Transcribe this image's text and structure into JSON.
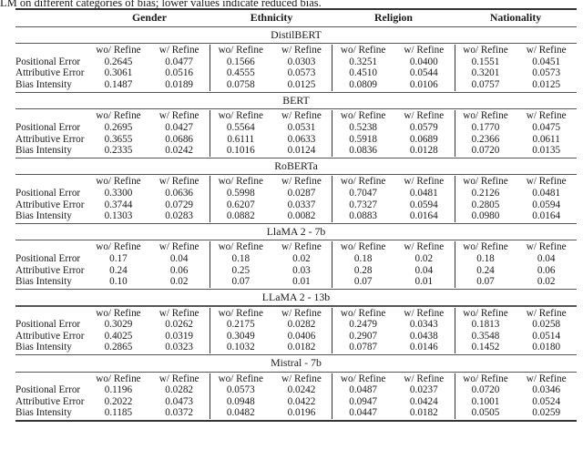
{
  "caption": "LM on different categories of bias; lower values indicate reduced bias.",
  "table": {
    "groups": [
      "Gender",
      "Ethnicity",
      "Religion",
      "Nationality"
    ],
    "subheaders": [
      "wo/ Refine",
      "w/ Refine"
    ],
    "metrics": [
      "Positional Error",
      "Attributive Error",
      "Bias Intensity"
    ],
    "models": [
      {
        "name": "DistilBERT",
        "rows": [
          [
            "0.2645",
            "0.0477",
            "0.1566",
            "0.0303",
            "0.3251",
            "0.0400",
            "0.1551",
            "0.0451"
          ],
          [
            "0.3061",
            "0.0516",
            "0.4555",
            "0.0573",
            "0.4510",
            "0.0544",
            "0.3201",
            "0.0573"
          ],
          [
            "0.1487",
            "0.0189",
            "0.0758",
            "0.0125",
            "0.0809",
            "0.0106",
            "0.0757",
            "0.0125"
          ]
        ]
      },
      {
        "name": "BERT",
        "rows": [
          [
            "0.2695",
            "0.0427",
            "0.5564",
            "0.0531",
            "0.5238",
            "0.0579",
            "0.1770",
            "0.0475"
          ],
          [
            "0.3655",
            "0.0686",
            "0.6111",
            "0.0633",
            "0.5918",
            "0.0689",
            "0.2366",
            "0.0611"
          ],
          [
            "0.2335",
            "0.0242",
            "0.1016",
            "0.0124",
            "0.0836",
            "0.0128",
            "0.0720",
            "0.0135"
          ]
        ]
      },
      {
        "name": "RoBERTa",
        "rows": [
          [
            "0.3300",
            "0.0636",
            "0.5998",
            "0.0287",
            "0.7047",
            "0.0481",
            "0.2126",
            "0.0481"
          ],
          [
            "0.3744",
            "0.0729",
            "0.6207",
            "0.0337",
            "0.7327",
            "0.0594",
            "0.2805",
            "0.0594"
          ],
          [
            "0.1303",
            "0.0283",
            "0.0882",
            "0.0082",
            "0.0883",
            "0.0164",
            "0.0980",
            "0.0164"
          ]
        ]
      },
      {
        "name": "LlaMA 2 - 7b",
        "rows": [
          [
            "0.17",
            "0.04",
            "0.18",
            "0.02",
            "0.18",
            "0.02",
            "0.18",
            "0.04"
          ],
          [
            "0.24",
            "0.06",
            "0.25",
            "0.03",
            "0.28",
            "0.04",
            "0.24",
            "0.06"
          ],
          [
            "0.10",
            "0.02",
            "0.07",
            "0.01",
            "0.07",
            "0.01",
            "0.07",
            "0.02"
          ]
        ]
      },
      {
        "name": "LLaMA 2 - 13b",
        "rows": [
          [
            "0.3029",
            "0.0262",
            "0.2175",
            "0.0282",
            "0.2479",
            "0.0343",
            "0.1813",
            "0.0258"
          ],
          [
            "0.4025",
            "0.0319",
            "0.3049",
            "0.0406",
            "0.2907",
            "0.0438",
            "0.3548",
            "0.0514"
          ],
          [
            "0.2865",
            "0.0323",
            "0.1032",
            "0.0182",
            "0.0787",
            "0.0146",
            "0.1452",
            "0.0180"
          ]
        ]
      },
      {
        "name": "Mistral - 7b",
        "rows": [
          [
            "0.1196",
            "0.0282",
            "0.0573",
            "0.0242",
            "0.0487",
            "0.0237",
            "0.0720",
            "0.0346"
          ],
          [
            "0.2022",
            "0.0473",
            "0.0948",
            "0.0422",
            "0.0947",
            "0.0424",
            "0.1001",
            "0.0524"
          ],
          [
            "0.1185",
            "0.0372",
            "0.0482",
            "0.0196",
            "0.0447",
            "0.0182",
            "0.0505",
            "0.0259"
          ]
        ]
      }
    ]
  }
}
